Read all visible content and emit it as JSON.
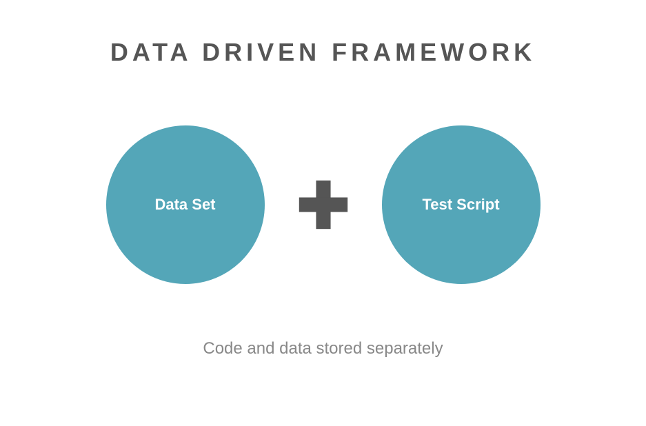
{
  "title": "DATA DRIVEN FRAMEWORK",
  "circles": {
    "left": "Data Set",
    "right": "Test Script"
  },
  "subtitle": "Code and data stored separately",
  "icons": {
    "plus": "plus-icon"
  },
  "colors": {
    "circle": "#54a6b8",
    "plus": "#555555",
    "title": "#555555",
    "subtitle": "#888888"
  }
}
